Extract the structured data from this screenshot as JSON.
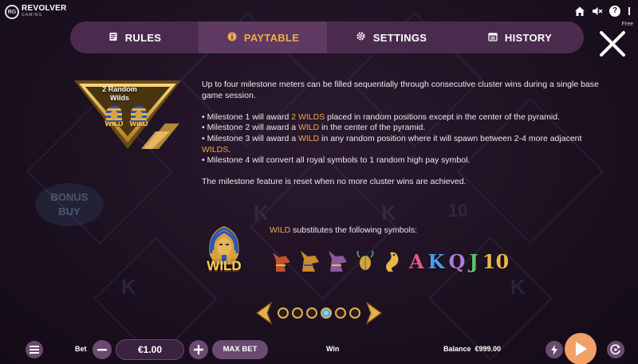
{
  "header": {
    "logo_mark": "RG",
    "logo_name": "REVOLVER",
    "logo_sub": "GAMING",
    "free_label": "Free"
  },
  "tabs": [
    {
      "label": "RULES",
      "icon": "book-icon",
      "active": false
    },
    {
      "label": "PAYTABLE",
      "icon": "info-icon",
      "active": true
    },
    {
      "label": "SETTINGS",
      "icon": "gear-icon",
      "active": false
    },
    {
      "label": "HISTORY",
      "icon": "calendar-icon",
      "active": false
    }
  ],
  "milestone_badge": {
    "label_line1": "2 Random",
    "label_line2": "Wilds",
    "wild_text": "WILD"
  },
  "description": {
    "intro": "Up to four milestone meters can be filled sequentially through consecutive cluster wins during a single base game session.",
    "m1_pre": "• Milestone 1 will award ",
    "m1_hl": "2 WILDS",
    "m1_post": " placed in random positions except in the center of the pyramid.",
    "m2_pre": "• Milestone 2 will award a ",
    "m2_hl": "WILD",
    "m2_post": " in the center of the pyramid.",
    "m3_pre": "• Milestone 3 will award a ",
    "m3_hl": "WILD",
    "m3_post": " in any random position where it will spawn between 2-4 more adjacent ",
    "m3_hl2": "WILDS",
    "m3_end": ".",
    "m4": "• Milestone 4 will convert all royal symbols to 1 random high pay symbol.",
    "reset": "The milestone feature is reset when no more cluster wins are achieved."
  },
  "wild_section": {
    "wild_label": "WILD",
    "big_wild_text": "WILD",
    "substitutes_text": " substitutes the following symbols:",
    "letters": [
      {
        "text": "A",
        "color": "#e85a8a"
      },
      {
        "text": "K",
        "color": "#4a9ee8"
      },
      {
        "text": "Q",
        "color": "#b07ad8"
      },
      {
        "text": "J",
        "color": "#5bc46a"
      },
      {
        "text": "10",
        "color": "#e8b84a"
      }
    ]
  },
  "pager": {
    "total": 6,
    "active_index": 3
  },
  "bottom_bar": {
    "bet_label": "Bet",
    "bet_value": "€1.00",
    "max_bet_label": "MAX BET",
    "win_label": "Win",
    "balance_label": "Balance",
    "balance_value": "€999.00"
  },
  "colors": {
    "accent": "#f2a94a",
    "tab_bar": "#4a2b4d",
    "spin_button": "#f2a06a"
  }
}
